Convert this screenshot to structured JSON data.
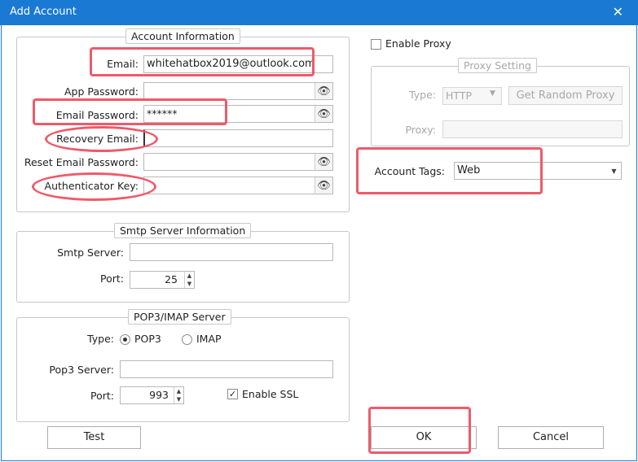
{
  "window": {
    "title": "Add Account",
    "close_glyph": "✕"
  },
  "account": {
    "legend": "Account Information",
    "email_label": "Email:",
    "email_value": "whitehatbox2019@outlook.com",
    "app_password_label": "App Password:",
    "email_password_label": "Email Password:",
    "email_password_value": "******",
    "recovery_email_label": "Recovery Email:",
    "recovery_email_value": "",
    "reset_email_password_label": "Reset Email Password:",
    "authenticator_key_label": "Authenticator Key:"
  },
  "smtp": {
    "legend": "Smtp Server Information",
    "server_label": "Smtp Server:",
    "server_value": "",
    "port_label": "Port:",
    "port_value": "25"
  },
  "pop": {
    "legend": "POP3/IMAP Server",
    "type_label": "Type:",
    "pop3_label": "POP3",
    "imap_label": "IMAP",
    "selected": "POP3",
    "server_label": "Pop3 Server:",
    "server_value": "",
    "port_label": "Port:",
    "port_value": "993",
    "ssl_label": "Enable SSL",
    "ssl_checked": true
  },
  "proxy": {
    "enable_label": "Enable Proxy",
    "enabled": false,
    "legend": "Proxy Setting",
    "type_label": "Type:",
    "type_value": "HTTP",
    "random_button": "Get Random Proxy",
    "proxy_label": "Proxy:",
    "proxy_value": ""
  },
  "tags": {
    "label": "Account Tags:",
    "value": "Web"
  },
  "buttons": {
    "test": "Test",
    "ok": "OK",
    "cancel": "Cancel"
  },
  "icons": {
    "eye": "eye-icon",
    "dropdown": "chevron-down-icon",
    "spin": "spin-arrows-icon"
  },
  "colors": {
    "titlebar": "#1979d3",
    "highlight": "#ee5a6a"
  }
}
